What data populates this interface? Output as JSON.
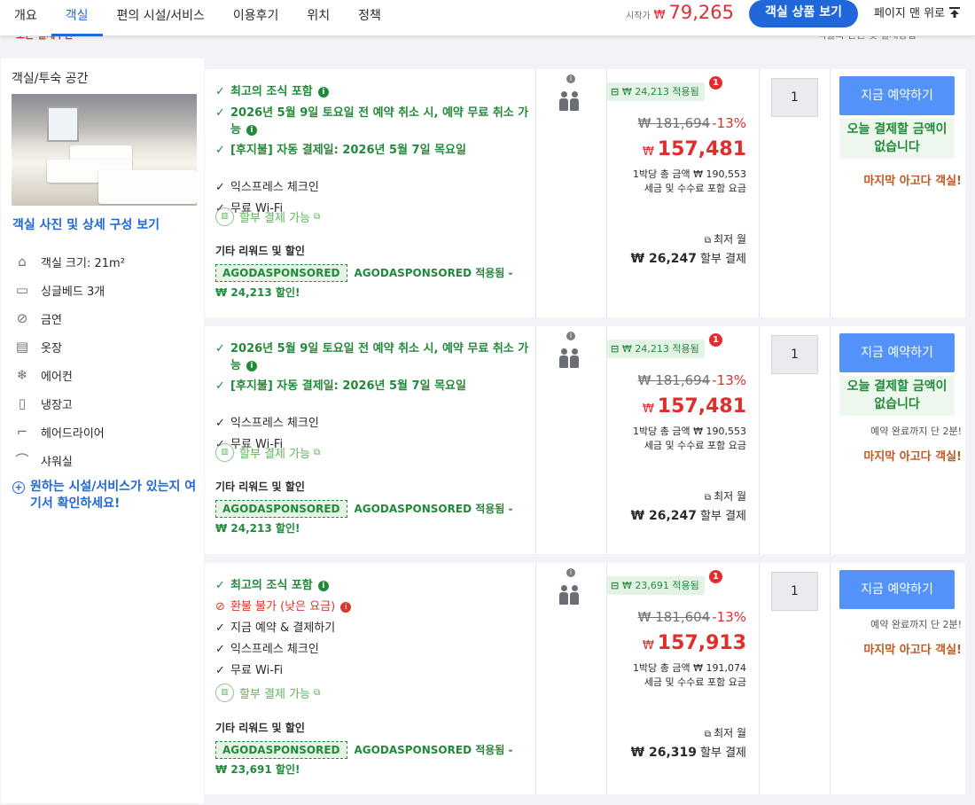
{
  "nav": {
    "tabs": [
      "개요",
      "객실",
      "편의 시설/서비스",
      "이용후기",
      "위치",
      "정책"
    ],
    "active_tab": "객실",
    "start_label": "시작가",
    "currency": "₩",
    "start_price": "79,265",
    "view_button": "객실 상품 보기",
    "back_to_top": "페이지 맨 위로"
  },
  "peek": {
    "left_text": "모든 결제수단",
    "right_text": "객실의 인원 및 결제방법"
  },
  "room": {
    "title": "객실/투숙 공간",
    "details_link": "객실 사진 및 상세 구성 보기",
    "facilities": [
      {
        "icon": "room-size-icon",
        "glyph": "⌂",
        "label": "객실 크기: 21m²"
      },
      {
        "icon": "bed-icon",
        "glyph": "▭",
        "label": "싱글베드 3개"
      },
      {
        "icon": "no-smoking-icon",
        "glyph": "⊘",
        "label": "금연"
      },
      {
        "icon": "closet-icon",
        "glyph": "▤",
        "label": "옷장"
      },
      {
        "icon": "air-conditioner-icon",
        "glyph": "❄",
        "label": "에어컨"
      },
      {
        "icon": "refrigerator-icon",
        "glyph": "▯",
        "label": "냉장고"
      },
      {
        "icon": "hair-dryer-icon",
        "glyph": "⌐",
        "label": "헤어드라이어"
      },
      {
        "icon": "shower-icon",
        "glyph": "⌒",
        "label": "샤워실"
      }
    ],
    "more_facilities": "원하는 시설/서비스가 있는지 여기서 확인하세요!"
  },
  "offers": [
    {
      "features": [
        {
          "type": "green",
          "mark": "✓",
          "text": "최고의 조식 포함",
          "info": true
        },
        {
          "type": "green",
          "mark": "✓",
          "text": "2026년 5월 9일 토요일 전 예약 취소 시, 예약 무료 취소 가능",
          "info": true
        },
        {
          "type": "green",
          "mark": "✓",
          "text": "[후지불] 자동 결제일: 2026년 5월 7일 목요일",
          "info": false
        },
        {
          "type": "plain",
          "mark": "✓",
          "text": "익스프레스 체크인",
          "info": false
        },
        {
          "type": "plain",
          "mark": "✓",
          "text": "무료 Wi-Fi",
          "info": false
        }
      ],
      "installment": "할부 결제 가능",
      "other_title": "기타 리워드 및 할인",
      "promo_badge": "AGODASPONSORED",
      "promo_text": "AGODASPONSORED 적용됨 - ₩ 24,213 할인!",
      "coupon": "₩ 24,213 적용됨",
      "alert": "1",
      "original_price": "₩ 181,694",
      "discount": "-13%",
      "price": "157,481",
      "per_night": "1박당 총 금액 ₩ 190,553",
      "tax_note": "세금 및 수수료 포함 요금",
      "lowest_label": "최저 월",
      "installment_amount": "₩ 26,247",
      "installment_label": "할부 결제",
      "quantity": "1",
      "book_button": "지금 예약하기",
      "pay_now": "오늘 결제할 금액이 없습니다",
      "remaining": "",
      "last_room": "마지막 아고다 객실!"
    },
    {
      "features": [
        {
          "type": "green",
          "mark": "✓",
          "text": "2026년 5월 9일 토요일 전 예약 취소 시, 예약 무료 취소 가능",
          "info": true
        },
        {
          "type": "green",
          "mark": "✓",
          "text": "[후지불] 자동 결제일: 2026년 5월 7일 목요일",
          "info": false
        },
        {
          "type": "plain",
          "mark": "✓",
          "text": "익스프레스 체크인",
          "info": false
        },
        {
          "type": "plain",
          "mark": "✓",
          "text": "무료 Wi-Fi",
          "info": false
        }
      ],
      "installment": "할부 결제 가능",
      "other_title": "기타 리워드 및 할인",
      "promo_badge": "AGODASPONSORED",
      "promo_text": "AGODASPONSORED 적용됨 - ₩ 24,213 할인!",
      "coupon": "₩ 24,213 적용됨",
      "alert": "1",
      "original_price": "₩ 181,694",
      "discount": "-13%",
      "price": "157,481",
      "per_night": "1박당 총 금액 ₩ 190,553",
      "tax_note": "세금 및 수수료 포함 요금",
      "lowest_label": "최저 월",
      "installment_amount": "₩ 26,247",
      "installment_label": "할부 결제",
      "quantity": "1",
      "book_button": "지금 예약하기",
      "pay_now": "오늘 결제할 금액이 없습니다",
      "remaining": "예약 완료까지 단 2분!",
      "last_room": "마지막 아고다 객실!"
    },
    {
      "features": [
        {
          "type": "green",
          "mark": "✓",
          "text": "최고의 조식 포함",
          "info": true
        },
        {
          "type": "red",
          "mark": "⊘",
          "text": "환불 불가 (낮은 요금)",
          "info": true
        },
        {
          "type": "plain",
          "mark": "✓",
          "text": "지금 예약 & 결제하기",
          "info": false
        },
        {
          "type": "plain",
          "mark": "✓",
          "text": "익스프레스 체크인",
          "info": false
        },
        {
          "type": "plain",
          "mark": "✓",
          "text": "무료 Wi-Fi",
          "info": false
        }
      ],
      "installment": "할부 결제 가능",
      "other_title": "기타 리워드 및 할인",
      "promo_badge": "AGODASPONSORED",
      "promo_text": "AGODASPONSORED 적용됨 - ₩ 23,691 할인!",
      "coupon": "₩ 23,691 적용됨",
      "alert": "1",
      "original_price": "₩ 181,604",
      "discount": "-13%",
      "price": "157,913",
      "per_night": "1박당 총 금액 ₩ 191,074",
      "tax_note": "세금 및 수수료 포함 요금",
      "lowest_label": "최저 월",
      "installment_amount": "₩ 26,319",
      "installment_label": "할부 결제",
      "quantity": "1",
      "book_button": "지금 예약하기",
      "pay_now": "",
      "remaining": "예약 완료까지 단 2분!",
      "last_room": "마지막 아고다 객실!"
    }
  ],
  "colors": {
    "accent": "#2067da",
    "button": "#5392f9",
    "price_red": "#e12d2d",
    "benefit_green": "#218a3a",
    "last_room_orange": "#c1581f"
  }
}
